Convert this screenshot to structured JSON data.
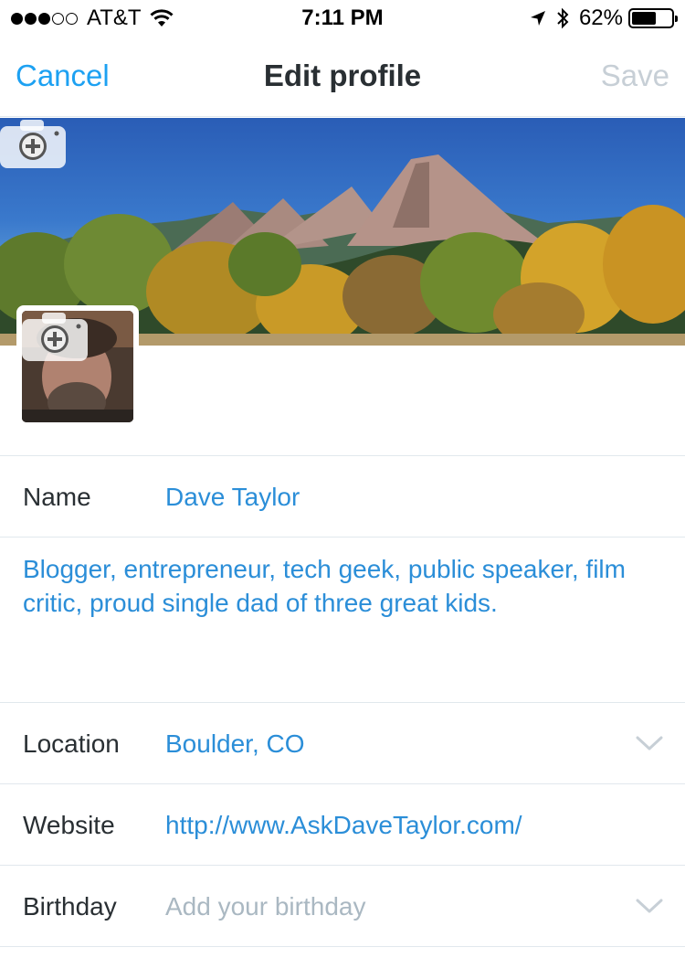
{
  "status_bar": {
    "carrier": "AT&T",
    "signal_dots_full": 3,
    "signal_dots_total": 5,
    "time": "7:11 PM",
    "battery_percent": "62%",
    "battery_level": 0.62
  },
  "nav": {
    "cancel_label": "Cancel",
    "title": "Edit profile",
    "save_label": "Save"
  },
  "header_image": {
    "icon": "camera-add-icon"
  },
  "avatar": {
    "icon": "camera-add-icon"
  },
  "form": {
    "name_label": "Name",
    "name_value": "Dave Taylor",
    "bio_value": "Blogger, entrepreneur, tech geek, public speaker, film critic, proud single dad of three great kids.",
    "location_label": "Location",
    "location_value": "Boulder, CO",
    "website_label": "Website",
    "website_value": "http://www.AskDaveTaylor.com/",
    "birthday_label": "Birthday",
    "birthday_placeholder": "Add your birthday"
  },
  "colors": {
    "accent": "#1da1f2",
    "value_text": "#2b8ed8",
    "disabled": "#c7cfd6",
    "divider": "#e1e8ed"
  }
}
